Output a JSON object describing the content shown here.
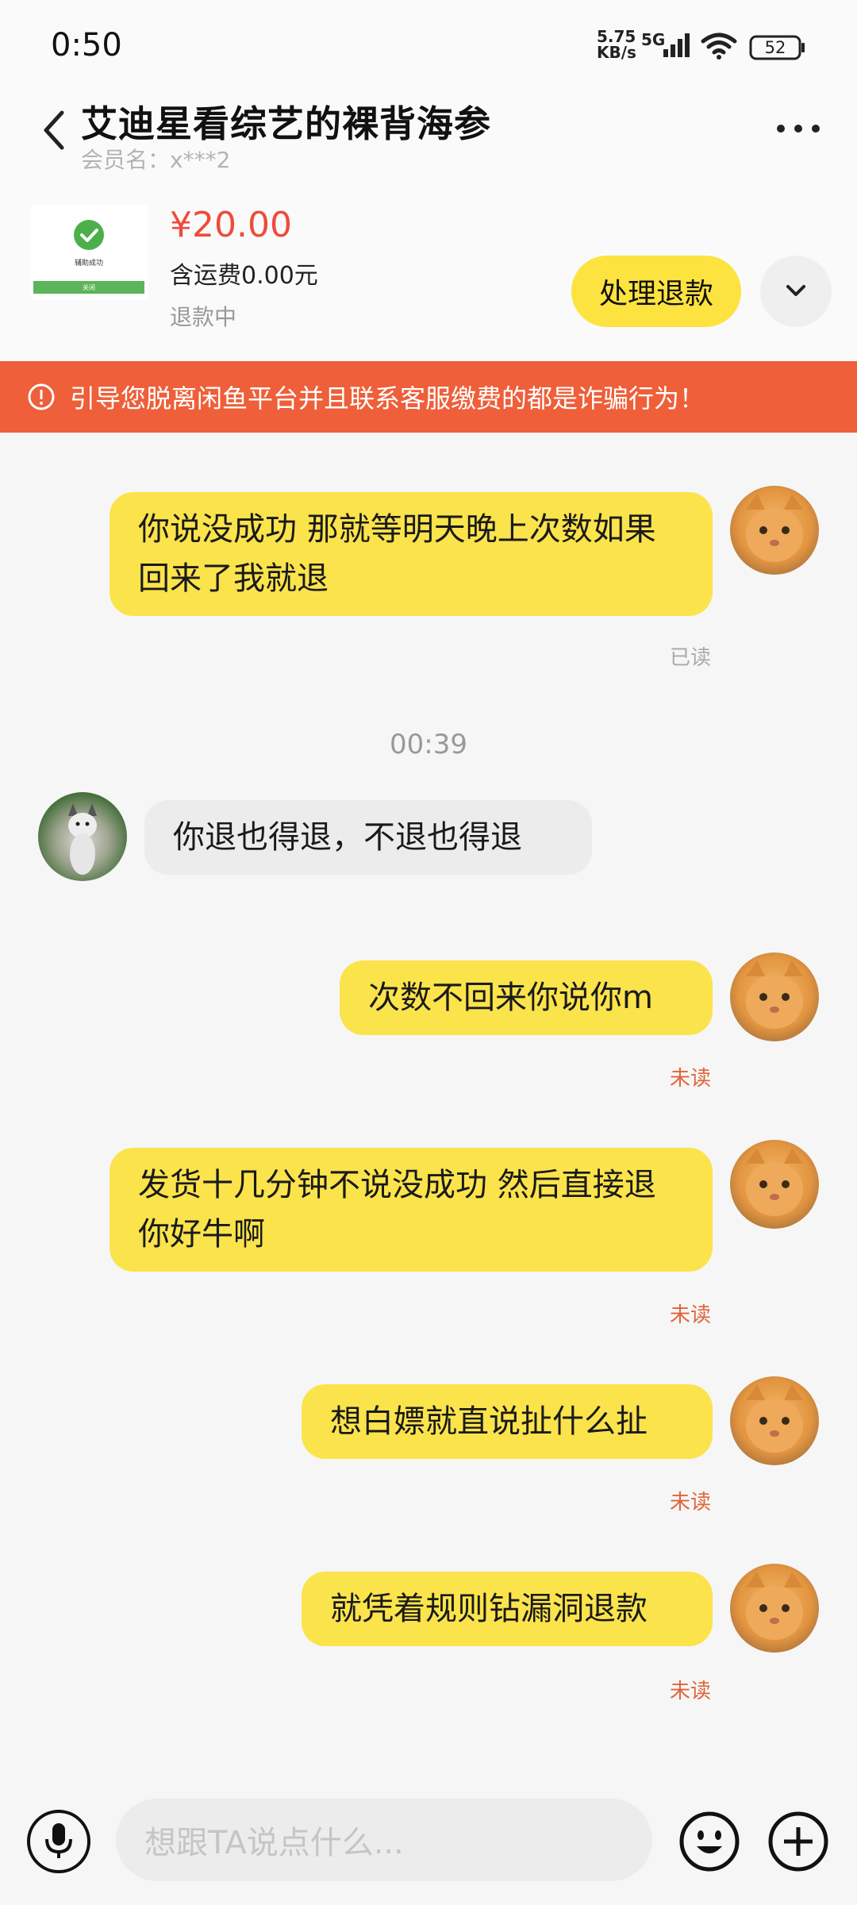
{
  "status_bar": {
    "time": "0:50",
    "net_speed_value": "5.75",
    "net_speed_unit": "KB/s",
    "network": "5G",
    "battery": "52"
  },
  "header": {
    "title": "艾迪星看综艺的裸背海参",
    "member_label": "会员名：x***2"
  },
  "order": {
    "price": "¥20.00",
    "shipping": "含运费0.00元",
    "status": "退款中",
    "refund_button": "处理退款",
    "thumb_text": "辅助成功",
    "thumb_bar_text": "关闭"
  },
  "warning": {
    "text": "引导您脱离闲鱼平台并且联系客服缴费的都是诈骗行为！"
  },
  "chat": {
    "timestamp": "00:39",
    "messages": [
      {
        "text": "你说没成功 那就等明天晚上次数如果回来了我就退",
        "status": "已读"
      },
      {
        "text": "你退也得退，不退也得退"
      },
      {
        "text": "次数不回来你说你m",
        "status": "未读"
      },
      {
        "text": "发货十几分钟不说没成功 然后直接退你好牛啊",
        "status": "未读"
      },
      {
        "text": "想白嫖就直说扯什么扯",
        "status": "未读"
      },
      {
        "text": "就凭着规则钻漏洞退款",
        "status": "未读"
      }
    ]
  },
  "input": {
    "placeholder": "想跟TA说点什么..."
  },
  "colors": {
    "accent_yellow": "#fde33f",
    "warning_orange": "#ee5f3a",
    "price_red": "#ef4b3a",
    "unread_orange": "#e0643c"
  },
  "icons": [
    "back-icon",
    "more-icon",
    "chevron-down-icon",
    "warning-icon",
    "mic-icon",
    "emoji-icon",
    "plus-icon"
  ]
}
